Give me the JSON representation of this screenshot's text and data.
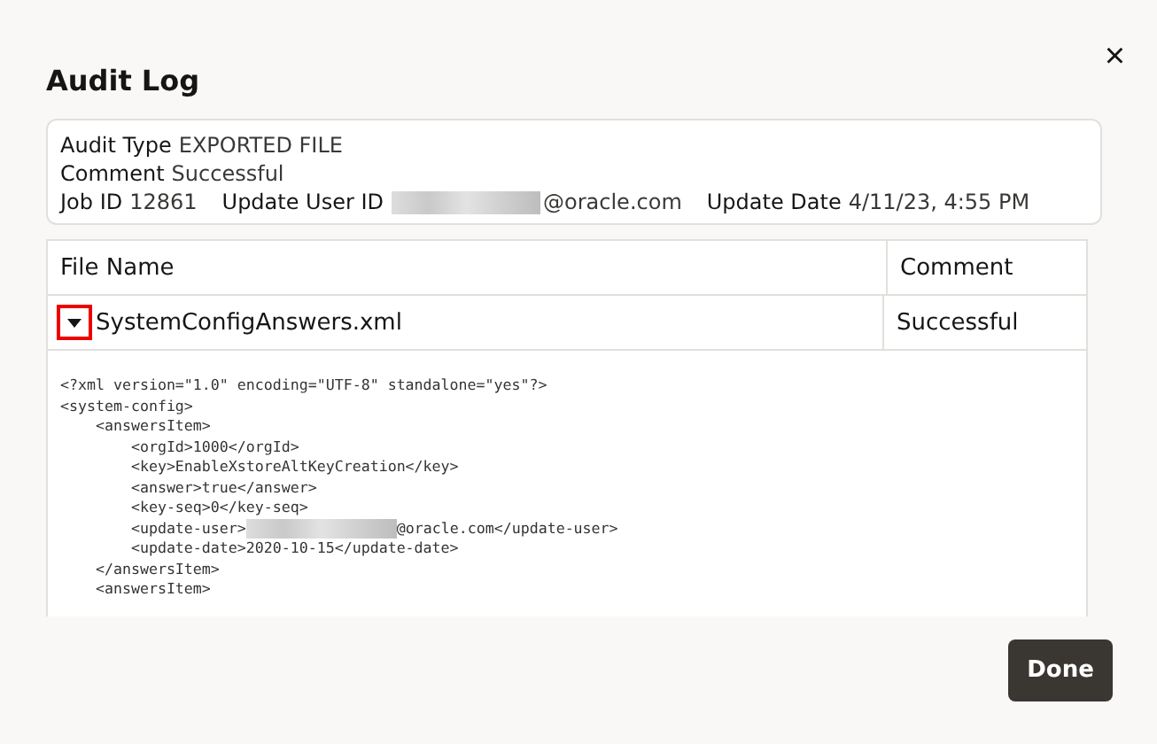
{
  "dialog": {
    "title": "Audit Log",
    "close": "×"
  },
  "summary": [
    {
      "label": "Audit Type",
      "value": "EXPORTED FILE"
    },
    {
      "label": "Comment",
      "value": "Successful"
    },
    {
      "label": "Job ID",
      "value": "12861"
    }
  ],
  "summary_extra": [
    {
      "label": "Update User ID",
      "redacted": true,
      "value": "@oracle.com"
    },
    {
      "label": "Update Date",
      "redacted": false,
      "value": "4/11/23, 4:55 PM"
    }
  ],
  "table": {
    "columns": [
      "File Name",
      "Comment"
    ],
    "rows": [
      {
        "expanded": true,
        "file": "SystemConfigAnswers.xml",
        "comment": "Successful"
      }
    ]
  },
  "code_lines": [
    {
      "kind": "text",
      "text": "<?xml version=\"1.0\" encoding=\"UTF-8\" standalone=\"yes\"?>"
    },
    {
      "kind": "text",
      "text": "<system-config>"
    },
    {
      "kind": "text",
      "text": "    <answersItem>"
    },
    {
      "kind": "text",
      "text": "        <orgId>1000</orgId>"
    },
    {
      "kind": "text",
      "text": "        <key>EnableXstoreAltKeyCreation</key>"
    },
    {
      "kind": "text",
      "text": "        <answer>true</answer>"
    },
    {
      "kind": "text",
      "text": "        <key-seq>0</key-seq>"
    },
    {
      "kind": "redacted",
      "text": "        <update-user>",
      "after": "@oracle.com</update-user>"
    },
    {
      "kind": "text",
      "text": "        <update-date>2020-10-15</update-date>"
    },
    {
      "kind": "text",
      "text": "    </answersItem>"
    },
    {
      "kind": "text",
      "text": "    <answersItem>"
    }
  ],
  "buttons": [
    "Done"
  ]
}
